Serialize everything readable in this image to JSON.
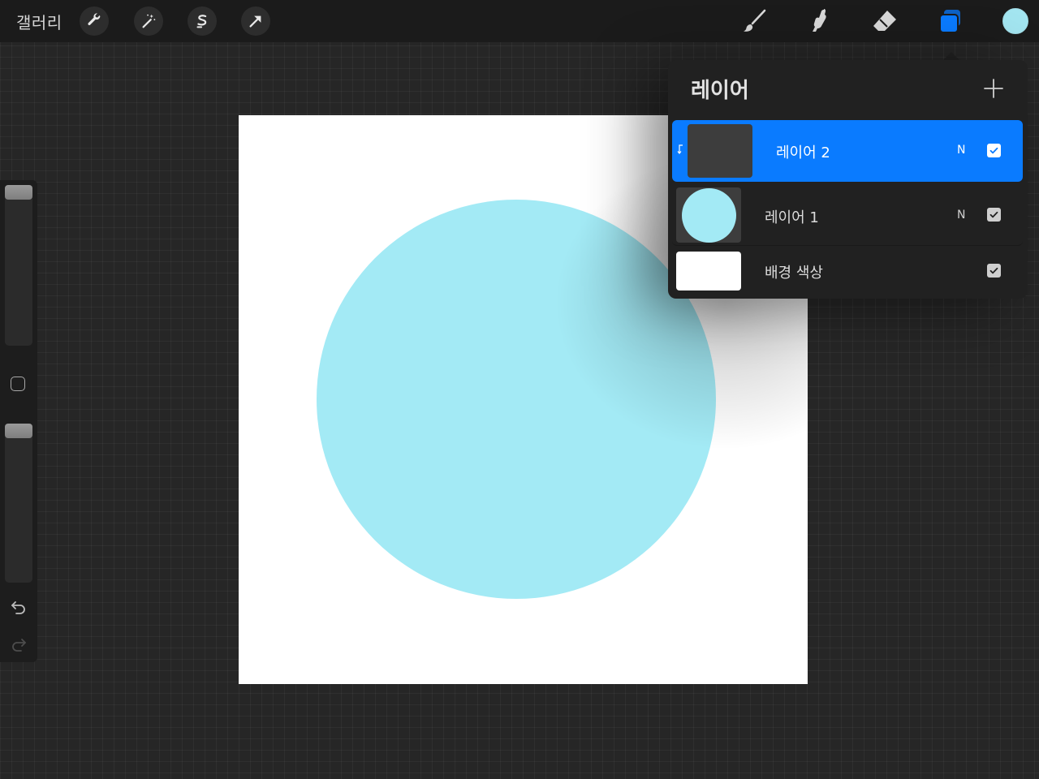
{
  "topbar": {
    "gallery_label": "갤러리",
    "left_tools": [
      "wrench-icon",
      "magic-wand-icon",
      "selection-s-icon",
      "transform-arrow-icon"
    ],
    "right_tools": [
      "brush-icon",
      "smudge-icon",
      "eraser-icon",
      "layers-icon"
    ],
    "active_color": "#a3e5f0",
    "layers_icon_color": "#0a7bff"
  },
  "sidebar": {
    "brush_size_level": 0.0,
    "opacity_level": 0.0,
    "icons": [
      "undo-icon",
      "redo-icon",
      "modifier-square-icon"
    ]
  },
  "canvas": {
    "background": "#ffffff",
    "circle_color": "#a3eaf5"
  },
  "layers_panel": {
    "title": "레이어",
    "add_icon": "plus-icon",
    "layers": [
      {
        "name": "레이어 2",
        "blend": "N",
        "visible": true,
        "selected": true,
        "clipping": true,
        "thumb": "empty-dark"
      },
      {
        "name": "레이어 1",
        "blend": "N",
        "visible": true,
        "selected": false,
        "clipping": false,
        "thumb": "cyan-circle"
      },
      {
        "name": "배경 색상",
        "blend": "",
        "visible": true,
        "selected": false,
        "clipping": false,
        "thumb": "white"
      }
    ],
    "accent": "#0a7bff"
  }
}
